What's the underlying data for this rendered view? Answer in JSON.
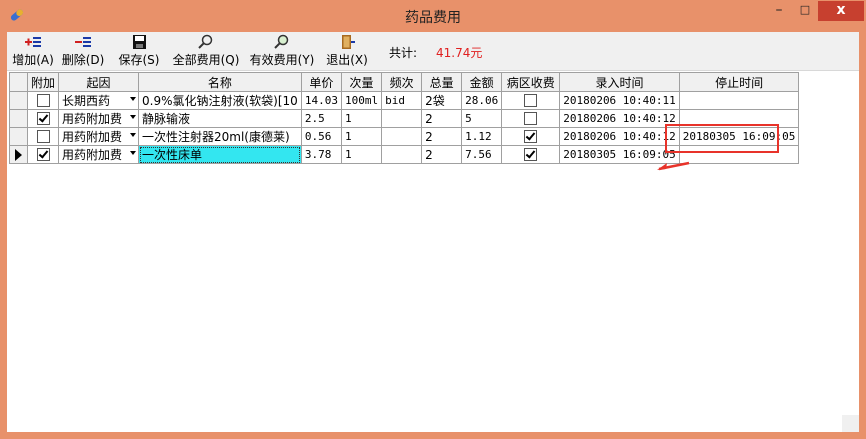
{
  "window": {
    "title": "药品费用",
    "minimize": "–",
    "maximize": "□",
    "close": "x"
  },
  "toolbar": {
    "add": "增加(A)",
    "delete": "删除(D)",
    "save": "保存(S)",
    "all_fees": "全部费用(Q)",
    "valid_fees": "有效费用(Y)",
    "exit": "退出(X)",
    "total_label": "共计:",
    "total_value": "41.74元",
    "icons": {
      "add": "add-row-icon",
      "delete": "delete-row-icon",
      "save": "floppy-disk-icon",
      "all_fees": "magnifier-icon",
      "valid_fees": "magnifier-icon",
      "exit": "exit-door-icon"
    }
  },
  "grid": {
    "columns": [
      "附加",
      "起因",
      "名称",
      "单价",
      "次量",
      "频次",
      "总量",
      "金额",
      "病区收费",
      "录入时间",
      "停止时间"
    ],
    "rows": [
      {
        "current": false,
        "attached": false,
        "cause": "长期西药",
        "name": "0.9%氯化钠注射液(软袋)[10",
        "price": "14.03",
        "dose": "100ml",
        "freq": "bid",
        "total": "2袋",
        "amount": "28.06",
        "ward_fee": false,
        "entry_time": "20180206 10:40:11",
        "stop_time": ""
      },
      {
        "current": false,
        "attached": true,
        "cause": "用药附加费",
        "name": "静脉输液",
        "price": "2.5",
        "dose": "1",
        "freq": "",
        "total": "2",
        "amount": "5",
        "ward_fee": false,
        "entry_time": "20180206 10:40:12",
        "stop_time": ""
      },
      {
        "current": false,
        "attached": false,
        "cause": "用药附加费",
        "name": "一次性注射器20ml(康德莱)",
        "price": "0.56",
        "dose": "1",
        "freq": "",
        "total": "2",
        "amount": "1.12",
        "ward_fee": true,
        "entry_time": "20180206 10:40:12",
        "stop_time": "20180305 16:09:05"
      },
      {
        "current": true,
        "attached": true,
        "cause": "用药附加费",
        "name": "一次性床单",
        "price": "3.78",
        "dose": "1",
        "freq": "",
        "total": "2",
        "amount": "7.56",
        "ward_fee": true,
        "entry_time": "20180305 16:09:05",
        "stop_time": ""
      }
    ]
  },
  "colors": {
    "titlebar": "#e8916a",
    "close_button": "#c7402f",
    "total_value": "#e02020",
    "selected_cell": "#33e6f0",
    "annotation": "#e8332a"
  }
}
